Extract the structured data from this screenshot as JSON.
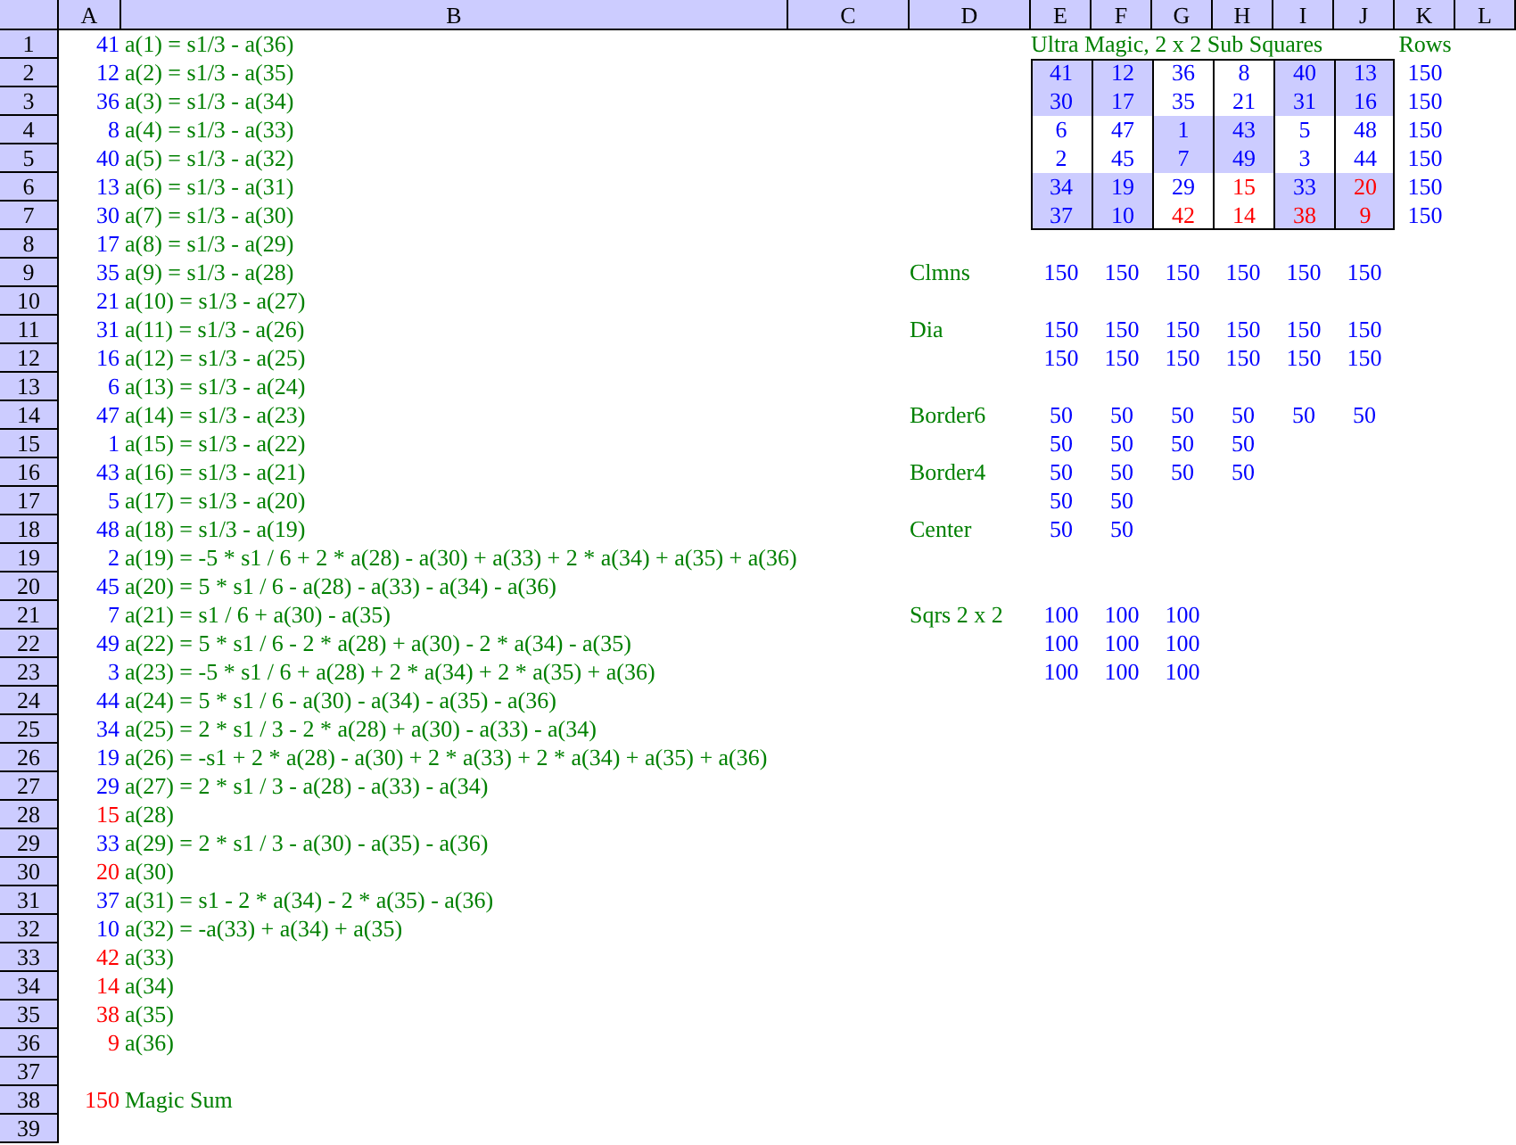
{
  "columns": [
    "A",
    "B",
    "C",
    "D",
    "E",
    "F",
    "G",
    "H",
    "I",
    "J",
    "K",
    "L"
  ],
  "row_numbers": [
    "1",
    "2",
    "3",
    "4",
    "5",
    "6",
    "7",
    "8",
    "9",
    "10",
    "11",
    "12",
    "13",
    "14",
    "15",
    "16",
    "17",
    "18",
    "19",
    "20",
    "21",
    "22",
    "23",
    "24",
    "25",
    "26",
    "27",
    "28",
    "29",
    "30",
    "31",
    "32",
    "33",
    "34",
    "35",
    "36",
    "37",
    "38",
    "39"
  ],
  "equations": [
    {
      "value": "41",
      "color": "#0000ff",
      "formula": "a(1) = s1/3 - a(36)"
    },
    {
      "value": "12",
      "color": "#0000ff",
      "formula": "a(2) = s1/3 - a(35)"
    },
    {
      "value": "36",
      "color": "#0000ff",
      "formula": "a(3) = s1/3 - a(34)"
    },
    {
      "value": "8",
      "color": "#0000ff",
      "formula": "a(4) = s1/3 - a(33)"
    },
    {
      "value": "40",
      "color": "#0000ff",
      "formula": "a(5) = s1/3 - a(32)"
    },
    {
      "value": "13",
      "color": "#0000ff",
      "formula": "a(6) = s1/3 - a(31)"
    },
    {
      "value": "30",
      "color": "#0000ff",
      "formula": "a(7) = s1/3 - a(30)"
    },
    {
      "value": "17",
      "color": "#0000ff",
      "formula": "a(8) = s1/3 - a(29)"
    },
    {
      "value": "35",
      "color": "#0000ff",
      "formula": "a(9) = s1/3 - a(28)"
    },
    {
      "value": "21",
      "color": "#0000ff",
      "formula": "a(10) = s1/3 - a(27)"
    },
    {
      "value": "31",
      "color": "#0000ff",
      "formula": "a(11) = s1/3 - a(26)"
    },
    {
      "value": "16",
      "color": "#0000ff",
      "formula": "a(12) = s1/3 - a(25)"
    },
    {
      "value": "6",
      "color": "#0000ff",
      "formula": "a(13) = s1/3 - a(24)"
    },
    {
      "value": "47",
      "color": "#0000ff",
      "formula": "a(14) = s1/3 - a(23)"
    },
    {
      "value": "1",
      "color": "#0000ff",
      "formula": "a(15) = s1/3 - a(22)"
    },
    {
      "value": "43",
      "color": "#0000ff",
      "formula": "a(16) = s1/3 - a(21)"
    },
    {
      "value": "5",
      "color": "#0000ff",
      "formula": "a(17) = s1/3 - a(20)"
    },
    {
      "value": "48",
      "color": "#0000ff",
      "formula": "a(18) = s1/3 - a(19)"
    },
    {
      "value": "2",
      "color": "#0000ff",
      "formula": "a(19) = -5 * s1 / 6 + 2 * a(28) - a(30) + a(33) + 2 * a(34) + a(35) + a(36)"
    },
    {
      "value": "45",
      "color": "#0000ff",
      "formula": "a(20) = 5 * s1 / 6 - a(28) - a(33) - a(34) - a(36)"
    },
    {
      "value": "7",
      "color": "#0000ff",
      "formula": "a(21) = s1 / 6 + a(30) - a(35)"
    },
    {
      "value": "49",
      "color": "#0000ff",
      "formula": "a(22) = 5 * s1 / 6 - 2 * a(28) + a(30) - 2 * a(34) - a(35)"
    },
    {
      "value": "3",
      "color": "#0000ff",
      "formula": "a(23) = -5 * s1 / 6 + a(28) + 2 * a(34) + 2 * a(35) + a(36)"
    },
    {
      "value": "44",
      "color": "#0000ff",
      "formula": "a(24) = 5 * s1 / 6 - a(30) - a(34) - a(35) - a(36)"
    },
    {
      "value": "34",
      "color": "#0000ff",
      "formula": "a(25) = 2 * s1 / 3 - 2 * a(28) + a(30) - a(33) - a(34)"
    },
    {
      "value": "19",
      "color": "#0000ff",
      "formula": "a(26) = -s1 + 2 * a(28) - a(30) + 2 * a(33) + 2 * a(34) + a(35) + a(36)"
    },
    {
      "value": "29",
      "color": "#0000ff",
      "formula": "a(27) = 2 * s1 / 3 - a(28) - a(33) - a(34)"
    },
    {
      "value": "15",
      "color": "#ff0000",
      "formula": "a(28)"
    },
    {
      "value": "33",
      "color": "#0000ff",
      "formula": "a(29) = 2 * s1 / 3 - a(30) - a(35) - a(36)"
    },
    {
      "value": "20",
      "color": "#ff0000",
      "formula": "a(30)"
    },
    {
      "value": "37",
      "color": "#0000ff",
      "formula": "a(31) = s1 - 2 * a(34) - 2 * a(35) - a(36)"
    },
    {
      "value": "10",
      "color": "#0000ff",
      "formula": "a(32) = -a(33) + a(34) + a(35)"
    },
    {
      "value": "42",
      "color": "#ff0000",
      "formula": "a(33)"
    },
    {
      "value": "14",
      "color": "#ff0000",
      "formula": "a(34)"
    },
    {
      "value": "38",
      "color": "#ff0000",
      "formula": "a(35)"
    },
    {
      "value": "9",
      "color": "#ff0000",
      "formula": "a(36)"
    }
  ],
  "magic_sum": {
    "value": "150",
    "label": "Magic Sum"
  },
  "square": {
    "title": "Ultra Magic, 2 x 2 Sub Squares",
    "sums_label": "Rows",
    "rows": [
      {
        "sum": "150",
        "cells": [
          {
            "text": "41",
            "color": "#0000ff",
            "shaded": true
          },
          {
            "text": "12",
            "color": "#0000ff",
            "shaded": true
          },
          {
            "text": "36",
            "color": "#0000ff",
            "shaded": false
          },
          {
            "text": "8",
            "color": "#0000ff",
            "shaded": false
          },
          {
            "text": "40",
            "color": "#0000ff",
            "shaded": true
          },
          {
            "text": "13",
            "color": "#0000ff",
            "shaded": true
          }
        ]
      },
      {
        "sum": "150",
        "cells": [
          {
            "text": "30",
            "color": "#0000ff",
            "shaded": true
          },
          {
            "text": "17",
            "color": "#0000ff",
            "shaded": true
          },
          {
            "text": "35",
            "color": "#0000ff",
            "shaded": false
          },
          {
            "text": "21",
            "color": "#0000ff",
            "shaded": false
          },
          {
            "text": "31",
            "color": "#0000ff",
            "shaded": true
          },
          {
            "text": "16",
            "color": "#0000ff",
            "shaded": true
          }
        ]
      },
      {
        "sum": "150",
        "cells": [
          {
            "text": "6",
            "color": "#0000ff",
            "shaded": false
          },
          {
            "text": "47",
            "color": "#0000ff",
            "shaded": false
          },
          {
            "text": "1",
            "color": "#0000ff",
            "shaded": true
          },
          {
            "text": "43",
            "color": "#0000ff",
            "shaded": true
          },
          {
            "text": "5",
            "color": "#0000ff",
            "shaded": false
          },
          {
            "text": "48",
            "color": "#0000ff",
            "shaded": false
          }
        ]
      },
      {
        "sum": "150",
        "cells": [
          {
            "text": "2",
            "color": "#0000ff",
            "shaded": false
          },
          {
            "text": "45",
            "color": "#0000ff",
            "shaded": false
          },
          {
            "text": "7",
            "color": "#0000ff",
            "shaded": true
          },
          {
            "text": "49",
            "color": "#0000ff",
            "shaded": true
          },
          {
            "text": "3",
            "color": "#0000ff",
            "shaded": false
          },
          {
            "text": "44",
            "color": "#0000ff",
            "shaded": false
          }
        ]
      },
      {
        "sum": "150",
        "cells": [
          {
            "text": "34",
            "color": "#0000ff",
            "shaded": true
          },
          {
            "text": "19",
            "color": "#0000ff",
            "shaded": true
          },
          {
            "text": "29",
            "color": "#0000ff",
            "shaded": false
          },
          {
            "text": "15",
            "color": "#ff0000",
            "shaded": false
          },
          {
            "text": "33",
            "color": "#0000ff",
            "shaded": true
          },
          {
            "text": "20",
            "color": "#ff0000",
            "shaded": true
          }
        ]
      },
      {
        "sum": "150",
        "cells": [
          {
            "text": "37",
            "color": "#0000ff",
            "shaded": true
          },
          {
            "text": "10",
            "color": "#0000ff",
            "shaded": true
          },
          {
            "text": "42",
            "color": "#ff0000",
            "shaded": false
          },
          {
            "text": "14",
            "color": "#ff0000",
            "shaded": false
          },
          {
            "text": "38",
            "color": "#ff0000",
            "shaded": true
          },
          {
            "text": "9",
            "color": "#ff0000",
            "shaded": true
          }
        ]
      }
    ]
  },
  "checks": [
    {
      "label": "Clmns",
      "lines": [
        [
          "150",
          "150",
          "150",
          "150",
          "150",
          "150"
        ]
      ]
    },
    {
      "label": "Dia",
      "lines": [
        [
          "150",
          "150",
          "150",
          "150",
          "150",
          "150"
        ],
        [
          "150",
          "150",
          "150",
          "150",
          "150",
          "150"
        ]
      ]
    },
    {
      "label": "Border6",
      "lines": [
        [
          "50",
          "50",
          "50",
          "50",
          "50",
          "50"
        ],
        [
          "50",
          "50",
          "50",
          "50"
        ]
      ]
    },
    {
      "label": "Border4",
      "lines": [
        [
          "50",
          "50",
          "50",
          "50"
        ],
        [
          "50",
          "50"
        ]
      ]
    },
    {
      "label": "Center",
      "lines": [
        [
          "50",
          "50"
        ]
      ]
    },
    {
      "label": "Sqrs 2 x 2",
      "lines": [
        [
          "100",
          "100",
          "100"
        ],
        [
          "100",
          "100",
          "100"
        ],
        [
          "100",
          "100",
          "100"
        ]
      ]
    }
  ]
}
